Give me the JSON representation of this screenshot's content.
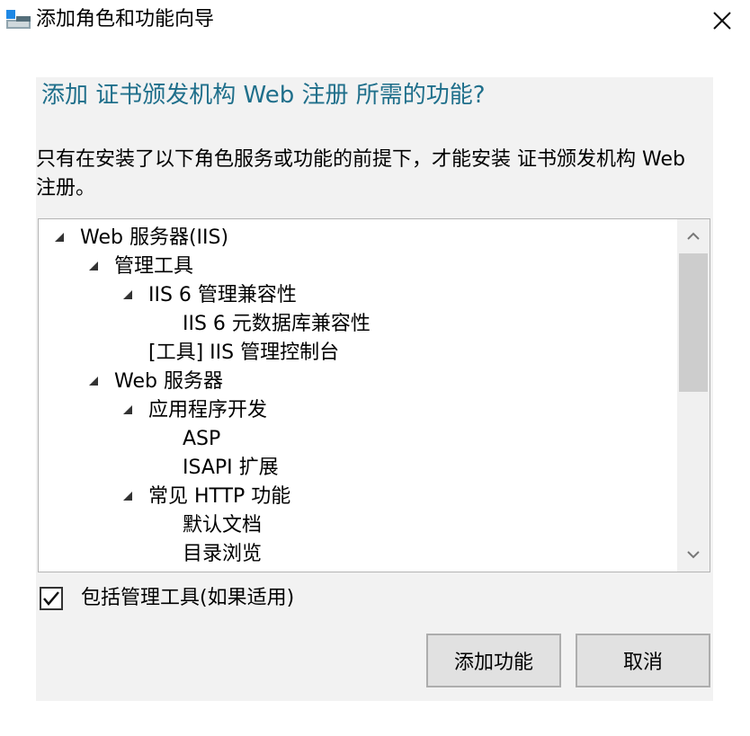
{
  "window": {
    "title": "添加角色和功能向导",
    "icon": "server-manager-icon",
    "close_icon": "close-icon"
  },
  "dialog": {
    "heading": "添加 证书颁发机构 Web 注册 所需的功能?",
    "description": "只有在安装了以下角色服务或功能的前提下，才能安装 证书颁发机构 Web 注册。",
    "tree": [
      {
        "label": "Web 服务器(IIS)",
        "expanded": true
      },
      {
        "label": "管理工具",
        "expanded": true
      },
      {
        "label": "IIS 6 管理兼容性",
        "expanded": true
      },
      {
        "label": "IIS 6 元数据库兼容性",
        "expanded": false
      },
      {
        "label": "[工具] IIS 管理控制台",
        "expanded": false
      },
      {
        "label": "Web 服务器",
        "expanded": true
      },
      {
        "label": "应用程序开发",
        "expanded": true
      },
      {
        "label": "ASP",
        "expanded": false
      },
      {
        "label": "ISAPI 扩展",
        "expanded": false
      },
      {
        "label": "常见 HTTP 功能",
        "expanded": true
      },
      {
        "label": "默认文档",
        "expanded": false
      },
      {
        "label": "目录浏览",
        "expanded": false
      }
    ],
    "include_tools": {
      "label": "包括管理工具(如果适用)",
      "checked": true
    },
    "buttons": {
      "add": "添加功能",
      "cancel": "取消"
    }
  },
  "colors": {
    "heading": "#1f6f8b",
    "content_bg": "#f2f2f2",
    "button_bg": "#e1e1e1"
  }
}
